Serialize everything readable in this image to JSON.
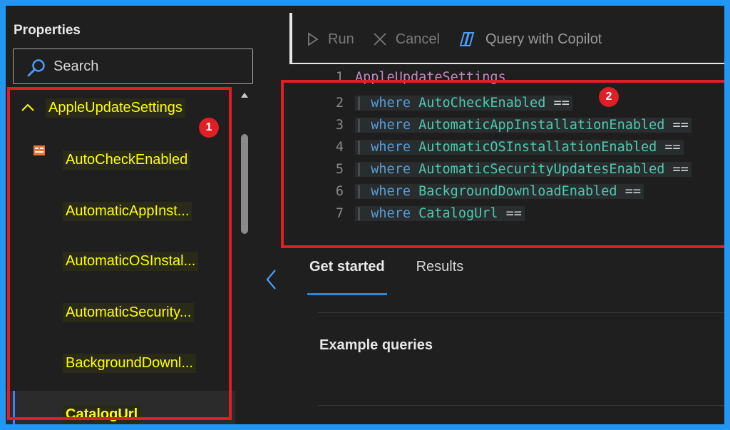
{
  "properties": {
    "title": "Properties",
    "search_placeholder": "Search",
    "table_node": "AppleUpdateSettings",
    "items": [
      {
        "label": "AutoCheckEnabled"
      },
      {
        "label": "AutomaticAppInst..."
      },
      {
        "label": "AutomaticOSInstal..."
      },
      {
        "label": "AutomaticSecurity..."
      },
      {
        "label": "BackgroundDownl..."
      },
      {
        "label": "CatalogUrl"
      }
    ]
  },
  "toolbar": {
    "run_label": "Run",
    "cancel_label": "Cancel",
    "copilot_label": "Query with Copilot"
  },
  "editor": {
    "lines": [
      {
        "number": "1",
        "pipe": "",
        "keyword": "",
        "field": "",
        "operator": "",
        "table": "AppleUpdateSettings"
      },
      {
        "number": "2",
        "pipe": "|",
        "keyword": "where",
        "field": "AutoCheckEnabled",
        "operator": "=="
      },
      {
        "number": "3",
        "pipe": "|",
        "keyword": "where",
        "field": "AutomaticAppInstallationEnabled",
        "operator": "=="
      },
      {
        "number": "4",
        "pipe": "|",
        "keyword": "where",
        "field": "AutomaticOSInstallationEnabled",
        "operator": "=="
      },
      {
        "number": "5",
        "pipe": "|",
        "keyword": "where",
        "field": "AutomaticSecurityUpdatesEnabled",
        "operator": "=="
      },
      {
        "number": "6",
        "pipe": "|",
        "keyword": "where",
        "field": "BackgroundDownloadEnabled",
        "operator": "=="
      },
      {
        "number": "7",
        "pipe": "|",
        "keyword": "where",
        "field": "CatalogUrl",
        "operator": "=="
      }
    ]
  },
  "tabs": [
    {
      "label": "Get started"
    },
    {
      "label": "Results"
    }
  ],
  "section_title": "Example queries",
  "annotations": {
    "badge_1": "1",
    "badge_2": "2"
  },
  "colors": {
    "frame_border": "#2196f3",
    "highlight_box": "#e01e26",
    "highlight_text": "#ffff00",
    "accent": "#2b88d8"
  }
}
